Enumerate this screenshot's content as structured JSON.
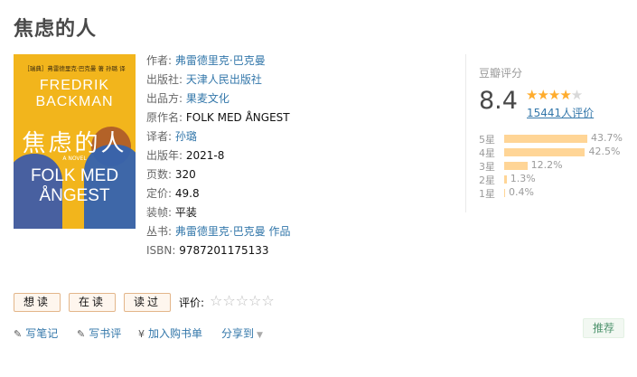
{
  "book": {
    "title": "焦虑的人"
  },
  "cover": {
    "top_line": "［瑞典］弗雷德里克·巴克曼 著 孙璐 译",
    "author_line1": "FREDRIK",
    "author_line2": "BACKMAN",
    "cn_title": "焦虑的人",
    "small_text": "A NOVEL",
    "en_title1": "FOLK MED",
    "en_title2": "ÅNGEST"
  },
  "info": {
    "author_label": "作者:",
    "author_value": "弗雷德里克·巴克曼",
    "publisher_label": "出版社:",
    "publisher_value": "天津人民出版社",
    "producer_label": "出品方:",
    "producer_value": "果麦文化",
    "original_title_label": "原作名:",
    "original_title_value": "FOLK MED ÅNGEST",
    "translator_label": "译者:",
    "translator_value": "孙璐",
    "pub_year_label": "出版年:",
    "pub_year_value": "2021-8",
    "pages_label": "页数:",
    "pages_value": "320",
    "price_label": "定价:",
    "price_value": "49.8",
    "binding_label": "装帧:",
    "binding_value": "平装",
    "series_label": "丛书:",
    "series_value": "弗雷德里克·巴克曼 作品",
    "isbn_label": "ISBN:",
    "isbn_value": "9787201175133"
  },
  "rating": {
    "header": "豆瓣评分",
    "score": "8.4",
    "stars_filled": 4,
    "stars_text_on": "★★★★",
    "stars_text_off": "★",
    "count": "15441人评价",
    "distribution": [
      {
        "label": "5星",
        "pct": "43.7%",
        "value": 43.7
      },
      {
        "label": "4星",
        "pct": "42.5%",
        "value": 42.5
      },
      {
        "label": "3星",
        "pct": "12.2%",
        "value": 12.2
      },
      {
        "label": "2星",
        "pct": "1.3%",
        "value": 1.3
      },
      {
        "label": "1星",
        "pct": "0.4%",
        "value": 0.4
      }
    ]
  },
  "actions": {
    "want_read": "想读",
    "reading": "在读",
    "have_read": "读过",
    "rate_label": "评价:",
    "rate_stars": "☆☆☆☆☆"
  },
  "links": {
    "write_note": "写笔记",
    "write_review": "写书评",
    "add_to_cart": "加入购书单",
    "share": "分享到"
  },
  "recommend": "推荐",
  "colors": {
    "link": "#3377aa",
    "star": "#ffac2d",
    "bar": "#ffd596",
    "recommend_text": "#4f946e",
    "cover_bg": "#f2b51c"
  }
}
